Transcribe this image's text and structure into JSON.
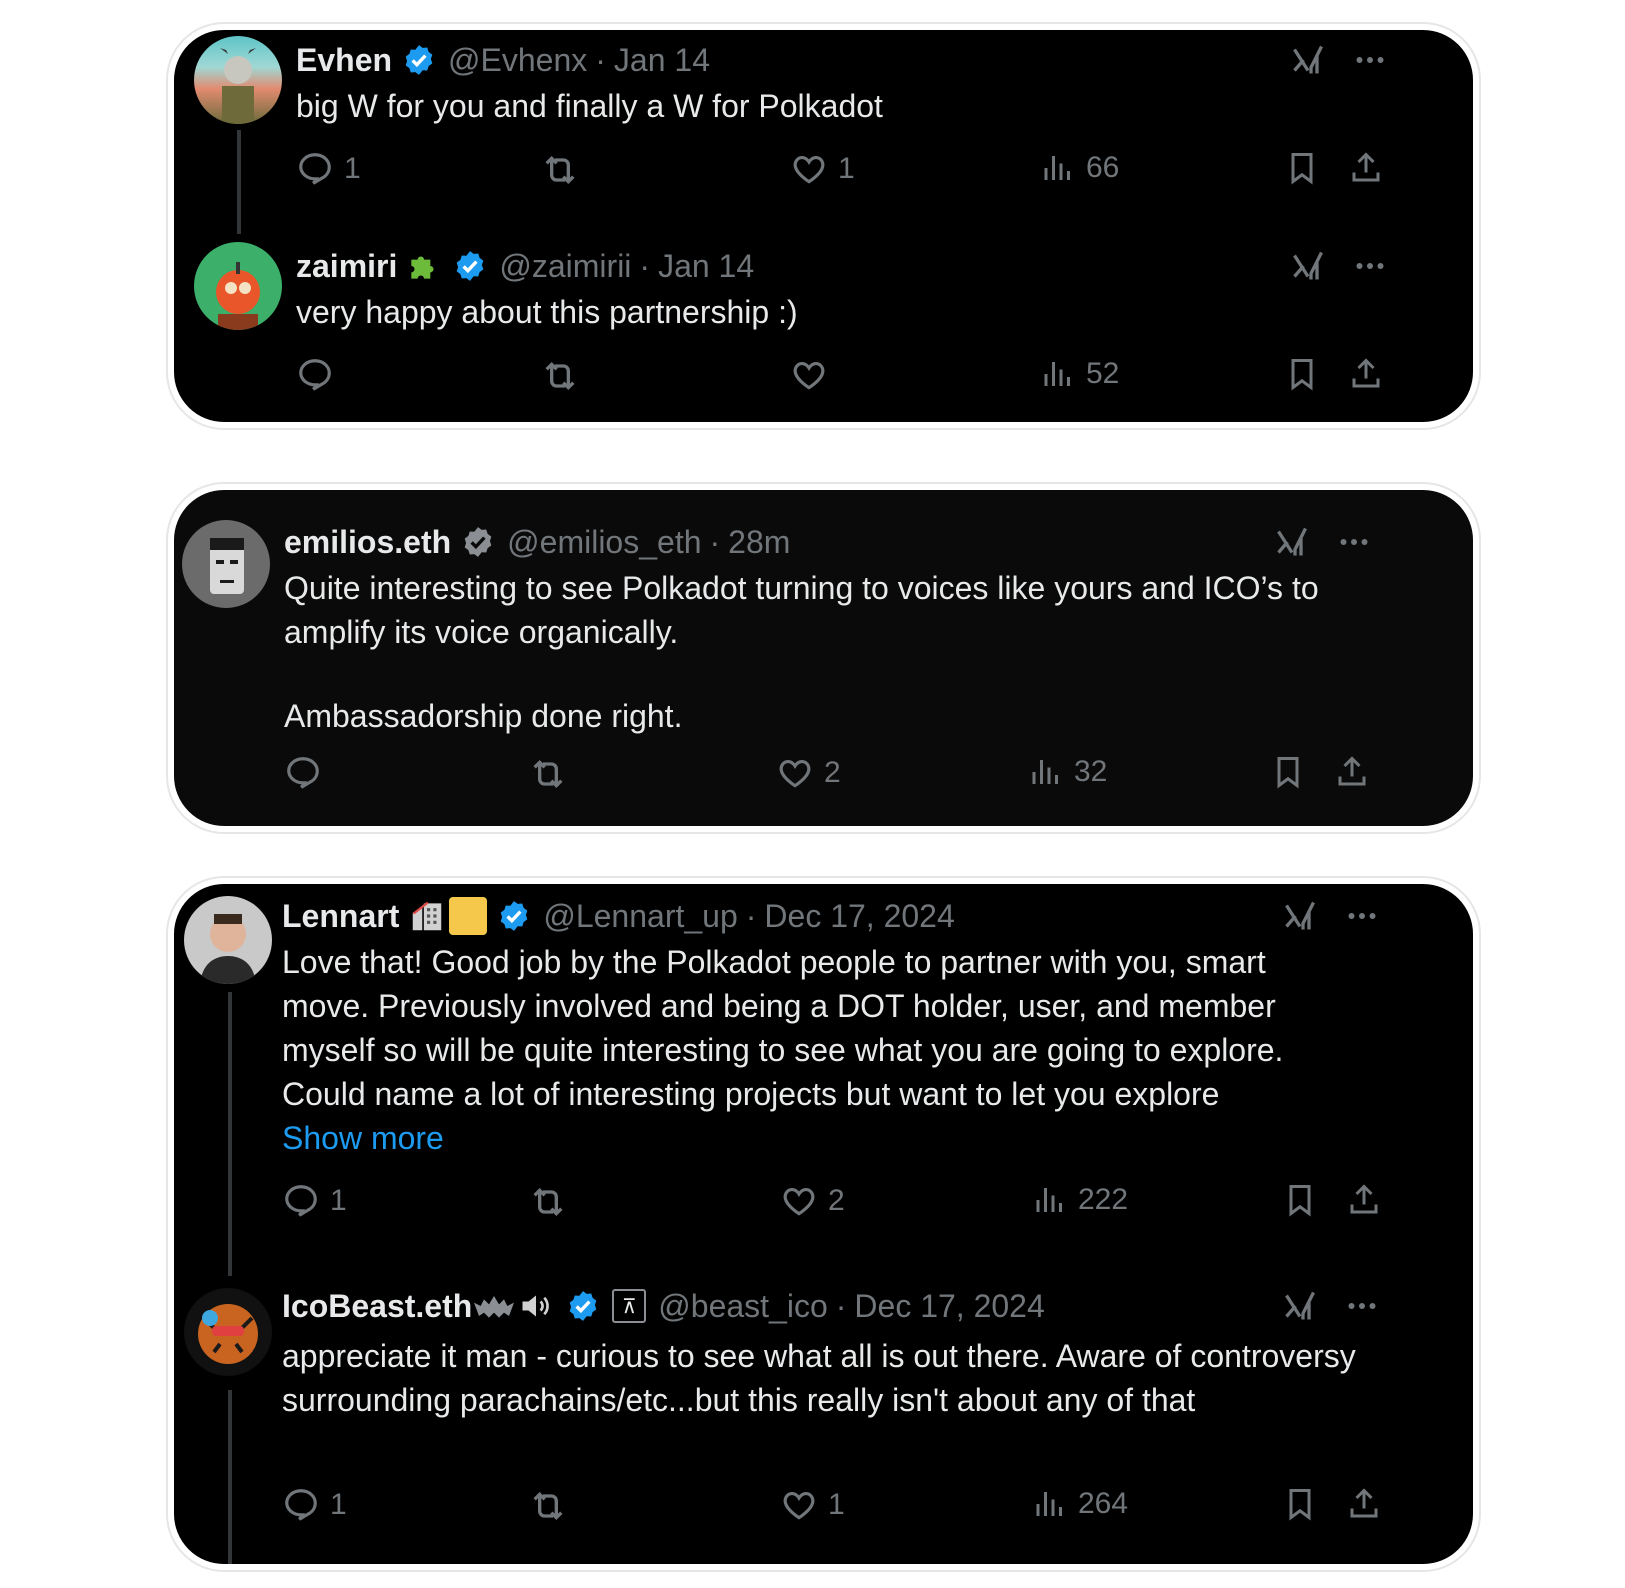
{
  "colors": {
    "accent": "#1d9bf0",
    "muted": "#71767b",
    "text": "#e7e9ea",
    "background": "#000000",
    "verified": "#1d9bf0"
  },
  "cards": [
    {
      "tweets": [
        {
          "name": "Evhen",
          "handle": "@Evhenx",
          "time": "Jan 14",
          "text": [
            "big W for you and finally a W for Polkadot"
          ],
          "replies": "1",
          "reposts": "",
          "likes": "1",
          "views": "66"
        },
        {
          "name": "zaimiri",
          "handle": "@zaimirii",
          "time": "Jan 14",
          "text": [
            "very happy about this partnership :)"
          ],
          "replies": "",
          "reposts": "",
          "likes": "",
          "views": "52"
        }
      ]
    },
    {
      "tweets": [
        {
          "name": "emilios.eth",
          "handle": "@emilios_eth",
          "time": "28m",
          "text": [
            "Quite interesting to see Polkadot turning to voices like yours and ICO’s to amplify its voice organically.",
            "Ambassadorship done right."
          ],
          "replies": "",
          "reposts": "",
          "likes": "2",
          "views": "32"
        }
      ]
    },
    {
      "tweets": [
        {
          "name": "Lennart",
          "handle": "@Lennart_up",
          "time": "Dec 17, 2024",
          "text": [
            "Love that! Good job by the Polkadot people to partner with you, smart move. Previously involved and being a DOT holder, user, and member myself so will be quite interesting to see what you are going to explore. Could name a lot of interesting projects but want to let you explore"
          ],
          "show_more": "Show more",
          "replies": "1",
          "reposts": "",
          "likes": "2",
          "views": "222"
        },
        {
          "name": "IcoBeast.eth",
          "handle": "@beast_ico",
          "time": "Dec 17, 2024",
          "text": [
            "appreciate it man - curious to see what all is out there. Aware of controversy surrounding parachains/etc...but this really isn't about any of that"
          ],
          "replies": "1",
          "reposts": "",
          "likes": "1",
          "views": "264"
        }
      ]
    }
  ],
  "separator": "·",
  "icons": [
    "reply-icon",
    "repost-icon",
    "like-icon",
    "views-icon",
    "bookmark-icon",
    "share-icon",
    "grok-icon",
    "more-icon",
    "verified-icon"
  ]
}
